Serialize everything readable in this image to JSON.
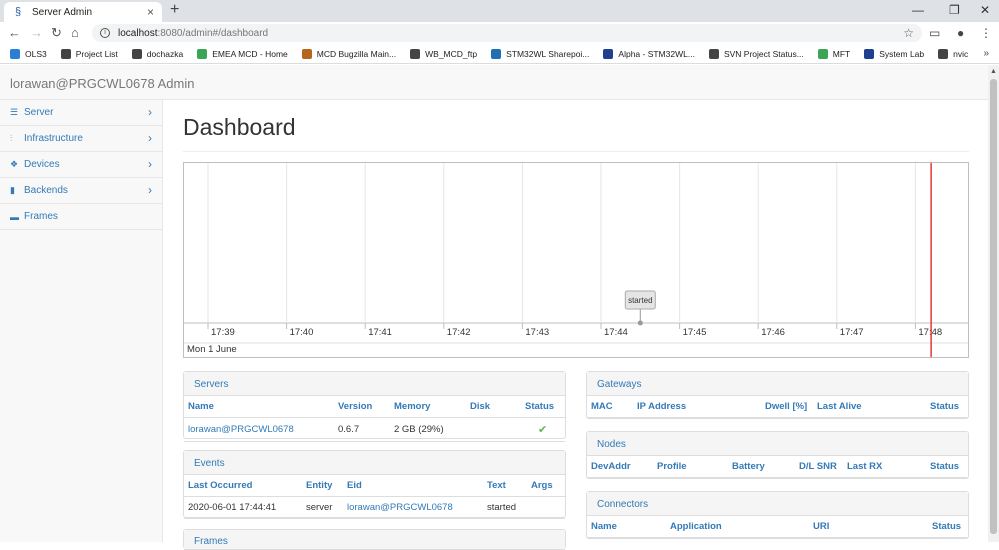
{
  "browser": {
    "tab_title": "Server Admin",
    "url_host": "localhost",
    "url_path": ":8080/admin#/dashboard",
    "bookmarks": [
      {
        "label": "OLS3",
        "color": "#2a7fd4"
      },
      {
        "label": "Project List",
        "color": "#444444"
      },
      {
        "label": "dochazka",
        "color": "#444444"
      },
      {
        "label": "EMEA MCD - Home",
        "color": "#3aa655"
      },
      {
        "label": "MCD Bugzilla Main...",
        "color": "#b5651d"
      },
      {
        "label": "WB_MCD_ftp",
        "color": "#444444"
      },
      {
        "label": "STM32WL Sharepoi...",
        "color": "#1f6fb2"
      },
      {
        "label": "Alpha - STM32WL...",
        "color": "#1f3f8f"
      },
      {
        "label": "SVN Project Status...",
        "color": "#444444"
      },
      {
        "label": "MFT",
        "color": "#3aa655"
      },
      {
        "label": "System Lab",
        "color": "#1f3f8f"
      },
      {
        "label": "nvic",
        "color": "#444444"
      }
    ]
  },
  "app": {
    "brand": "lorawan@PRGCWL0678 Admin"
  },
  "sidebar": {
    "items": [
      {
        "label": "Server",
        "icon": "list-icon",
        "has_children": true
      },
      {
        "label": "Infrastructure",
        "icon": "sitemap-icon",
        "has_children": true
      },
      {
        "label": "Devices",
        "icon": "cubes-icon",
        "has_children": true
      },
      {
        "label": "Backends",
        "icon": "chart-icon",
        "has_children": true
      },
      {
        "label": "Frames",
        "icon": "comments-icon",
        "has_children": false
      }
    ]
  },
  "dashboard": {
    "title": "Dashboard",
    "timeline": {
      "ticks": [
        "17:39",
        "17:40",
        "17:41",
        "17:42",
        "17:43",
        "17:44",
        "17:45",
        "17:46",
        "17:47",
        "17:48"
      ],
      "date_label": "Mon 1 June",
      "event_label": "started",
      "event_time_index": 5.5,
      "current_time_index": 9.2,
      "current_time_color": "#e53935"
    },
    "servers": {
      "heading": "Servers",
      "columns": [
        "Name",
        "Version",
        "Memory",
        "Disk",
        "Status"
      ],
      "rows": [
        {
          "name": "lorawan@PRGCWL0678",
          "version": "0.6.7",
          "memory": "2 GB (29%)",
          "disk": "",
          "status": "ok"
        }
      ]
    },
    "events": {
      "heading": "Events",
      "columns": [
        "Last Occurred",
        "Entity",
        "Eid",
        "Text",
        "Args"
      ],
      "rows": [
        {
          "last_occurred": "2020-06-01 17:44:41",
          "entity": "server",
          "eid": "lorawan@PRGCWL0678",
          "text": "started",
          "args": ""
        }
      ]
    },
    "frames": {
      "heading": "Frames"
    },
    "gateways": {
      "heading": "Gateways",
      "columns": [
        "MAC",
        "IP Address",
        "Dwell [%]",
        "Last Alive",
        "Status"
      ]
    },
    "nodes": {
      "heading": "Nodes",
      "columns": [
        "DevAddr",
        "Profile",
        "Battery",
        "D/L SNR",
        "Last RX",
        "Status"
      ]
    },
    "connectors": {
      "heading": "Connectors",
      "columns": [
        "Name",
        "Application",
        "URI",
        "Status"
      ]
    }
  }
}
